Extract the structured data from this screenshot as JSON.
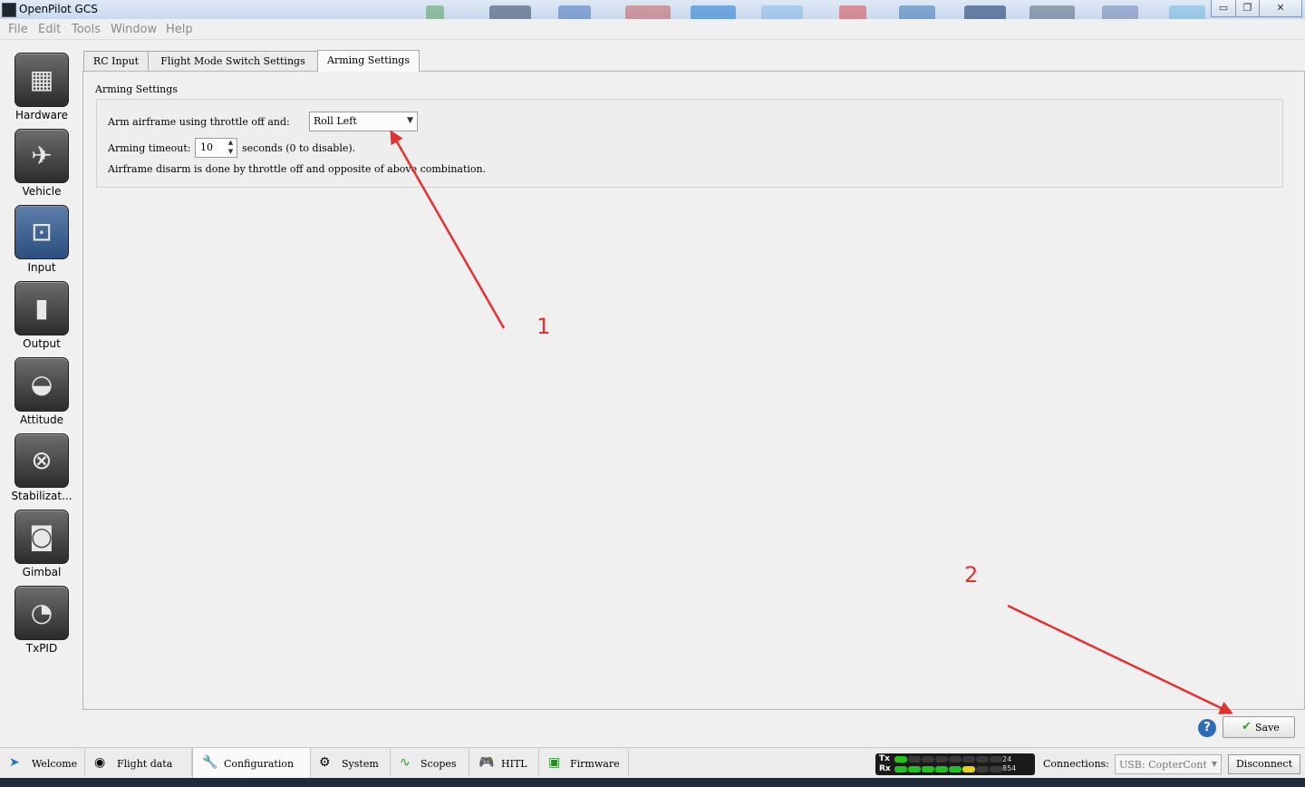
{
  "window": {
    "title": "OpenPilot GCS",
    "minimize_icon": "minimize-icon",
    "maximize_icon": "maximize-icon",
    "close_icon": "close-icon"
  },
  "menu": [
    "File",
    "Edit",
    "Tools",
    "Window",
    "Help"
  ],
  "sidebar": {
    "items": [
      {
        "label": "Hardware",
        "icon": "chip-icon"
      },
      {
        "label": "Vehicle",
        "icon": "aircraft-icon"
      },
      {
        "label": "Input",
        "icon": "transmitter-icon"
      },
      {
        "label": "Output",
        "icon": "motor-icon"
      },
      {
        "label": "Attitude",
        "icon": "level-icon"
      },
      {
        "label": "Stabilizat...",
        "icon": "gyro-icon"
      },
      {
        "label": "Gimbal",
        "icon": "camera-icon"
      },
      {
        "label": "TxPID",
        "icon": "gauge-icon"
      }
    ]
  },
  "tabs": [
    "RC Input",
    "Flight Mode Switch Settings",
    "Arming Settings"
  ],
  "arming": {
    "group_title": "Arming Settings",
    "arm_label": "Arm airframe using throttle off and:",
    "arm_value": "Roll Left",
    "timeout_label": "Arming timeout:",
    "timeout_value": "10",
    "timeout_suffix": "seconds (0 to disable).",
    "disarm_note": "Airframe disarm is done by throttle off and opposite of above combination."
  },
  "actions": {
    "help": "?",
    "save": "Save"
  },
  "bottom_tabs": [
    {
      "label": "Welcome",
      "icon": "bird-icon"
    },
    {
      "label": "Flight data",
      "icon": "pfd-icon"
    },
    {
      "label": "Configuration",
      "icon": "wrench-icon"
    },
    {
      "label": "System",
      "icon": "gear-icon"
    },
    {
      "label": "Scopes",
      "icon": "pulse-icon"
    },
    {
      "label": "HITL",
      "icon": "gamepad-icon"
    },
    {
      "label": "Firmware",
      "icon": "chip-icon"
    }
  ],
  "telemetry": {
    "tx_label": "Tx",
    "rx_label": "Rx",
    "tx_value": "24",
    "rx_value": "854",
    "color_on": "#22c21e",
    "color_warn": "#e8d218"
  },
  "connections": {
    "label": "Connections:",
    "device": "USB: CopterControl",
    "disconnect": "Disconnect"
  },
  "annotations": [
    {
      "label": "1"
    },
    {
      "label": "2"
    }
  ],
  "colors": {
    "annotation": "#e53030"
  }
}
